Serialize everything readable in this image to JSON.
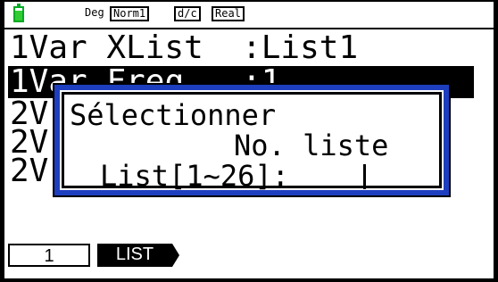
{
  "status_bar": {
    "battery_icon": "battery-icon",
    "badges": [
      "Deg",
      "Norm1",
      "d/c",
      "Real"
    ]
  },
  "list_rows": [
    {
      "label": "1Var XList  :List1"
    },
    {
      "label": "1Var Freq   :1"
    },
    {
      "label": "2V"
    },
    {
      "label": "2V"
    },
    {
      "label": "2V"
    }
  ],
  "dialog": {
    "line1": "Sélectionner",
    "line2": "No. liste",
    "prompt": "List[1~26]: ",
    "border_color": "#1d3fbf"
  },
  "function_keys": [
    {
      "label": "1"
    },
    {
      "label": "LIST"
    }
  ]
}
